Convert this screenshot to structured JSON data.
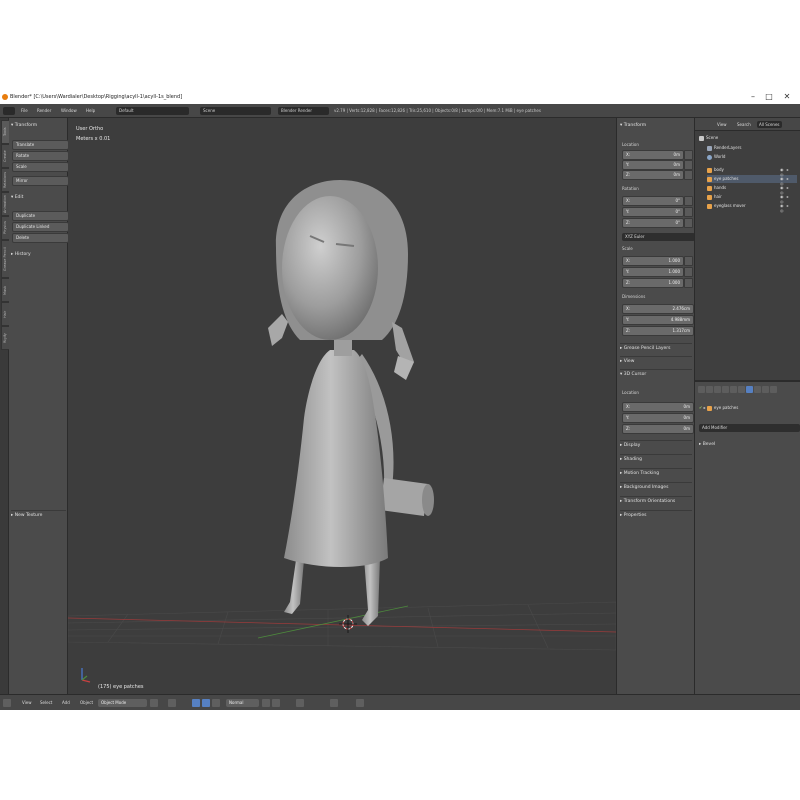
{
  "window": {
    "title": "Blender* [C:\\Users\\Wardialer\\Desktop\\Rigging\\acyll-1\\acyll-1s_blend]",
    "minimize": "–",
    "maximize": "□",
    "close": "✕"
  },
  "info_header": {
    "menus": [
      "File",
      "Render",
      "Window",
      "Help"
    ],
    "layout": "Default",
    "scene": "Scene",
    "engine": "Blender Render",
    "stats": "v2.79 | Verts:12,828 | Faces:12,826 | Tris:25,610 | Objects:0/8 | Lamps:0/0 | Mem:7.1 MiB | eye patches"
  },
  "left_tabs": [
    "Tools",
    "Create",
    "Relations",
    "Animation",
    "Physics",
    "Grease Pencil",
    "Mask",
    "Hair",
    "Rigify"
  ],
  "tool_shelf": {
    "transform_header": "Transform",
    "transform_buttons": [
      "Translate",
      "Rotate",
      "Scale",
      "Mirror"
    ],
    "edit_header": "Edit",
    "edit_buttons": [
      "Duplicate",
      "Duplicate Linked",
      "Delete"
    ],
    "history_header": "History",
    "new_texture": "New Texture"
  },
  "viewport": {
    "view_name": "User Ortho",
    "scale_label": "Meters x 0.01",
    "object_label": "(175) eye patches"
  },
  "n_panel": {
    "transform_header": "Transform",
    "location_label": "Location",
    "location": [
      {
        "axis": "X:",
        "value": "0m"
      },
      {
        "axis": "Y:",
        "value": "0m"
      },
      {
        "axis": "Z:",
        "value": "0m"
      }
    ],
    "rotation_label": "Rotation",
    "rotation": [
      {
        "axis": "X:",
        "value": "0°"
      },
      {
        "axis": "Y:",
        "value": "0°"
      },
      {
        "axis": "Z:",
        "value": "0°"
      }
    ],
    "rotation_mode": "XYZ Euler",
    "scale_label": "Scale",
    "scale": [
      {
        "axis": "X:",
        "value": "1.000"
      },
      {
        "axis": "Y:",
        "value": "1.000"
      },
      {
        "axis": "Z:",
        "value": "1.000"
      }
    ],
    "dimensions_label": "Dimensions",
    "dimensions": [
      {
        "axis": "X:",
        "value": "2.476cm"
      },
      {
        "axis": "Y:",
        "value": "4.988mm"
      },
      {
        "axis": "Z:",
        "value": "1.317cm"
      }
    ],
    "grease_pencil": "Grease Pencil Layers",
    "view": "View",
    "cursor_header": "3D Cursor",
    "cursor_location_label": "Location",
    "cursor_location": [
      {
        "axis": "X:",
        "value": "0m"
      },
      {
        "axis": "Y:",
        "value": "0m"
      },
      {
        "axis": "Z:",
        "value": "0m"
      }
    ],
    "collapsed": [
      "Display",
      "Shading",
      "Motion Tracking",
      "Background Images",
      "Transform Orientations",
      "Properties"
    ]
  },
  "outliner": {
    "tabs": [
      "View",
      "Search",
      "All Scenes"
    ],
    "rows": [
      {
        "label": "Scene",
        "indent": 0,
        "color": "#c9c9c9"
      },
      {
        "label": "RenderLayers",
        "indent": 1,
        "color": "#9aa6b8"
      },
      {
        "label": "World",
        "indent": 1,
        "color": "#8aa6c8"
      },
      {
        "label": "body",
        "indent": 1,
        "color": "#e8a24a"
      },
      {
        "label": "eye patches",
        "indent": 1,
        "color": "#e8a24a"
      },
      {
        "label": "hands",
        "indent": 1,
        "color": "#e8a24a"
      },
      {
        "label": "hair",
        "indent": 1,
        "color": "#e8a24a"
      },
      {
        "label": "eyeglass mover",
        "indent": 1,
        "color": "#e8a24a"
      }
    ],
    "eye_icons": "◉ ▸ ◎"
  },
  "properties": {
    "object_name": "eye patches",
    "add_modifier": "Add Modifier",
    "bevel_label": "Bevel"
  },
  "bottom_header": {
    "menus": [
      "View",
      "Select",
      "Add",
      "Object"
    ],
    "mode": "Object Mode",
    "pivot": "Normal"
  },
  "colors": {
    "viewport_bg": "#3d3d3d",
    "panel_bg": "#4b4b4b",
    "accent": "#5680c2",
    "object_orange": "#e8a24a",
    "grid_red": "#9a3b3b",
    "grid_green": "#4d8a3d"
  }
}
